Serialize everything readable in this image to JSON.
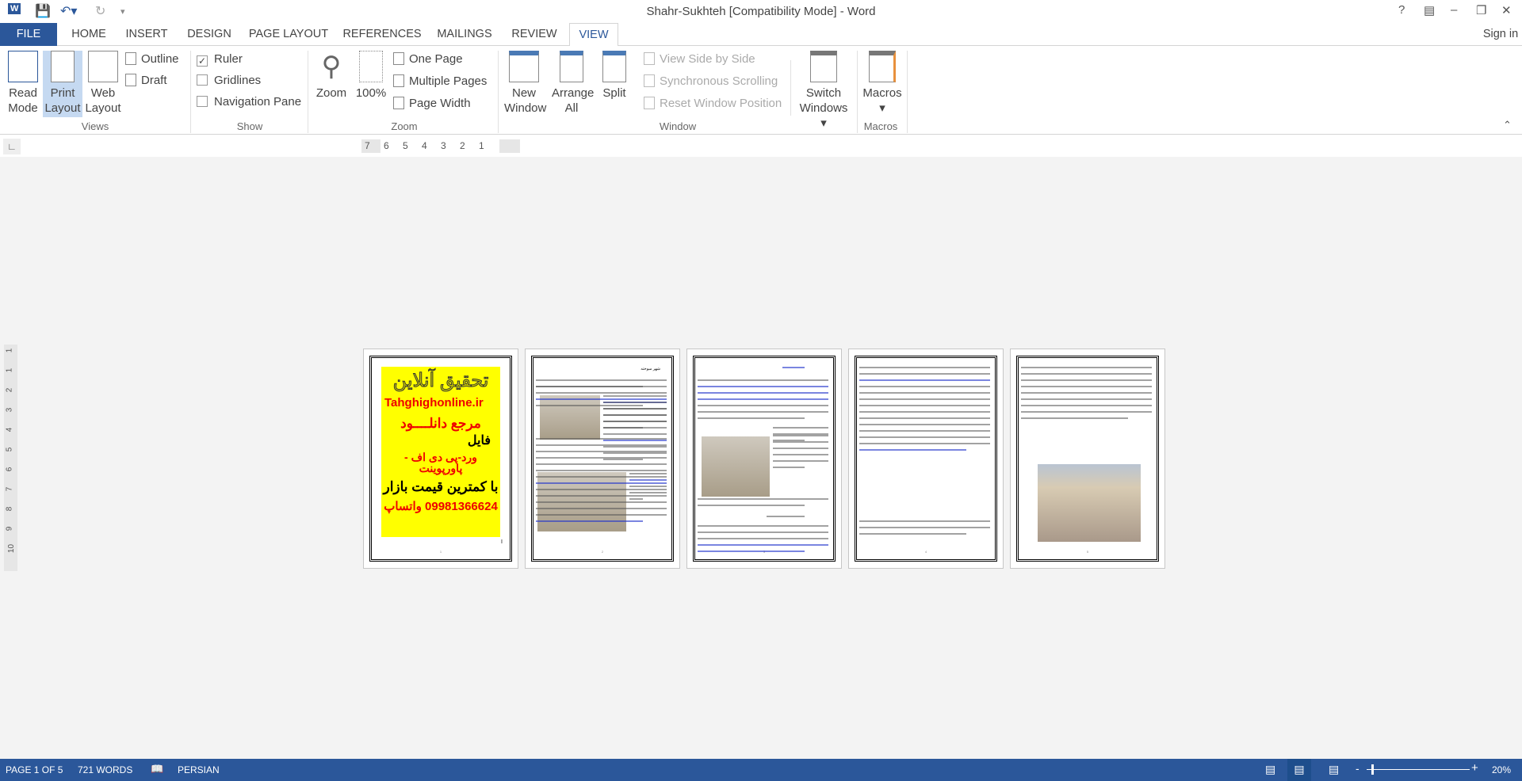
{
  "window": {
    "title": "Shahr-Sukhteh [Compatibility Mode] - Word",
    "controls": [
      "?",
      "restore-ribbon",
      "minimize",
      "restore",
      "close"
    ]
  },
  "tabs": [
    {
      "label": "FILE"
    },
    {
      "label": "HOME"
    },
    {
      "label": "INSERT"
    },
    {
      "label": "DESIGN"
    },
    {
      "label": "PAGE LAYOUT"
    },
    {
      "label": "REFERENCES"
    },
    {
      "label": "MAILINGS"
    },
    {
      "label": "REVIEW"
    },
    {
      "label": "VIEW",
      "active": true
    }
  ],
  "sign_in": "Sign in",
  "ribbon": {
    "views": {
      "label": "Views",
      "read_mode": "Read Mode",
      "print_layout": "Print Layout",
      "web_layout": "Web Layout",
      "outline": "Outline",
      "draft": "Draft",
      "selected": "Print Layout"
    },
    "show": {
      "label": "Show",
      "ruler": "Ruler",
      "ruler_checked": true,
      "gridlines": "Gridlines",
      "gridlines_checked": false,
      "navigation_pane": "Navigation Pane",
      "navigation_pane_checked": false
    },
    "zoom": {
      "label": "Zoom",
      "zoom": "Zoom",
      "hundred": "100%",
      "one_page": "One Page",
      "multiple_pages": "Multiple Pages",
      "page_width": "Page Width"
    },
    "window": {
      "label": "Window",
      "new_window": "New Window",
      "arrange_all": "Arrange All",
      "split": "Split",
      "side_by_side": "View Side by Side",
      "sync_scrolling": "Synchronous Scrolling",
      "reset_position": "Reset Window Position",
      "switch_windows": "Switch Windows"
    },
    "macros": {
      "label": "Macros",
      "macros": "Macros"
    }
  },
  "ruler": {
    "ticks": [
      "7",
      "6",
      "5",
      "4",
      "3",
      "2",
      "1"
    ],
    "vticks": [
      "1",
      "1",
      "2",
      "3",
      "4",
      "5",
      "6",
      "7",
      "8",
      "9",
      "10"
    ]
  },
  "pages": {
    "poster": {
      "title": "تحقیق آنلاین",
      "site": "Tahghighonline.ir",
      "line1": "مرجع دانلــــود",
      "line2": "فایل",
      "line3": "ورد-پی دی اف - پاورپوینت",
      "line4": "با کمترین قیمت بازار",
      "phone": "09981366624 واتساپ",
      "cursor": "I"
    },
    "page2_heading": "شهر سوخته"
  },
  "status": {
    "page": "PAGE 1 OF 5",
    "words": "721 WORDS",
    "language": "PERSIAN",
    "zoom": "20%",
    "zoom_percent": 20
  },
  "colors": {
    "accent": "#2b579a",
    "poster_bg": "#ffff00",
    "poster_red": "#ff0000"
  }
}
